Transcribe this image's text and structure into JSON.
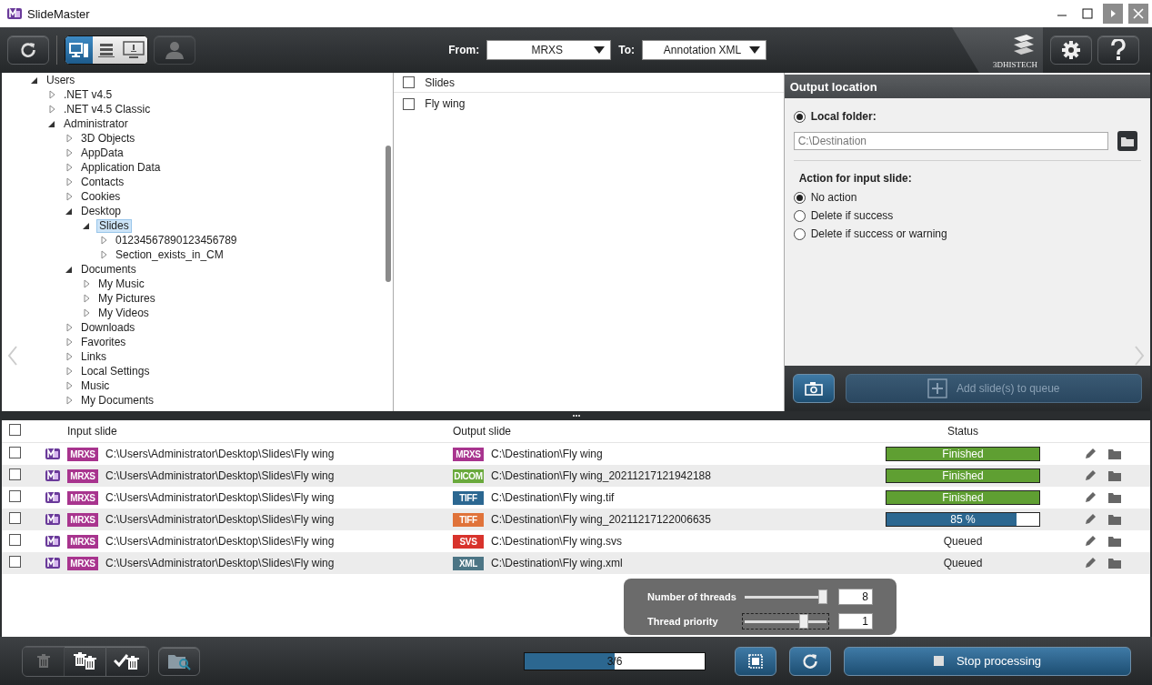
{
  "window": {
    "title": "SlideMaster"
  },
  "toolbar": {
    "view_modes": [
      {
        "selected": true
      },
      {
        "selected": false
      },
      {
        "selected": false
      }
    ],
    "from": {
      "label": "From:",
      "value": "MRXS"
    },
    "to": {
      "label": "To:",
      "value": "Annotation XML"
    },
    "logo": "3DHISTECH"
  },
  "tree": [
    {
      "label": "Users",
      "expanded": true,
      "selected": false,
      "children": [
        {
          "label": ".NET v4.5",
          "expanded": false,
          "selected": false
        },
        {
          "label": ".NET v4.5 Classic",
          "expanded": false,
          "selected": false
        },
        {
          "label": "Administrator",
          "expanded": true,
          "selected": false,
          "children": [
            {
              "label": "3D Objects",
              "expanded": false,
              "selected": false
            },
            {
              "label": "AppData",
              "expanded": false,
              "selected": false
            },
            {
              "label": "Application Data",
              "expanded": false,
              "selected": false
            },
            {
              "label": "Contacts",
              "expanded": false,
              "selected": false
            },
            {
              "label": "Cookies",
              "expanded": false,
              "selected": false
            },
            {
              "label": "Desktop",
              "expanded": true,
              "selected": false,
              "children": [
                {
                  "label": "Slides",
                  "expanded": true,
                  "selected": true,
                  "children": [
                    {
                      "label": "01234567890123456789",
                      "expanded": false,
                      "selected": false
                    },
                    {
                      "label": "Section_exists_in_CM",
                      "expanded": false,
                      "selected": false
                    }
                  ]
                }
              ]
            },
            {
              "label": "Documents",
              "expanded": true,
              "selected": false,
              "children": [
                {
                  "label": "My Music",
                  "expanded": false,
                  "selected": false
                },
                {
                  "label": "My Pictures",
                  "expanded": false,
                  "selected": false
                },
                {
                  "label": "My Videos",
                  "expanded": false,
                  "selected": false
                }
              ]
            },
            {
              "label": "Downloads",
              "expanded": false,
              "selected": false
            },
            {
              "label": "Favorites",
              "expanded": false,
              "selected": false
            },
            {
              "label": "Links",
              "expanded": false,
              "selected": false
            },
            {
              "label": "Local Settings",
              "expanded": false,
              "selected": false
            },
            {
              "label": "Music",
              "expanded": false,
              "selected": false
            },
            {
              "label": "My Documents",
              "expanded": false,
              "selected": false
            }
          ]
        }
      ]
    }
  ],
  "slides": {
    "header": {
      "label": "Slides",
      "checked": false
    },
    "items": [
      {
        "label": "Fly wing",
        "checked": false
      }
    ]
  },
  "output": {
    "title": "Output location",
    "local_folder": {
      "label": "Local folder:",
      "selected": true
    },
    "path": "C:\\Destination",
    "action_label": "Action for input slide:",
    "actions": [
      {
        "label": "No action",
        "selected": true
      },
      {
        "label": "Delete if success",
        "selected": false
      },
      {
        "label": "Delete if success or warning",
        "selected": false
      }
    ],
    "add_button": {
      "label": "Add slide(s) to queue",
      "disabled": true
    }
  },
  "queue": {
    "columns": [
      "Input slide",
      "Output slide",
      "Status"
    ],
    "all_checked": false,
    "rows": [
      {
        "checked": false,
        "input_format": {
          "label": "MRXS",
          "color": "#a8348e"
        },
        "input_path": "C:\\Users\\Administrator\\Desktop\\Slides\\Fly wing",
        "output_format": {
          "label": "MRXS",
          "color": "#a8348e"
        },
        "output_path": "C:\\Destination\\Fly wing",
        "status": {
          "kind": "finished",
          "text": "Finished",
          "level": 1
        }
      },
      {
        "checked": false,
        "input_format": {
          "label": "MRXS",
          "color": "#a8348e"
        },
        "input_path": "C:\\Users\\Administrator\\Desktop\\Slides\\Fly wing",
        "output_format": {
          "label": "DICOM",
          "color": "#6aa93c"
        },
        "output_path": "C:\\Destination\\Fly wing_20211217121942188",
        "status": {
          "kind": "finished",
          "text": "Finished",
          "level": 1
        }
      },
      {
        "checked": false,
        "input_format": {
          "label": "MRXS",
          "color": "#a8348e"
        },
        "input_path": "C:\\Users\\Administrator\\Desktop\\Slides\\Fly wing",
        "output_format": {
          "label": "TIFF",
          "color": "#2b6791"
        },
        "output_path": "C:\\Destination\\Fly wing.tif",
        "status": {
          "kind": "finished",
          "text": "Finished",
          "level": 1
        }
      },
      {
        "checked": false,
        "input_format": {
          "label": "MRXS",
          "color": "#a8348e"
        },
        "input_path": "C:\\Users\\Administrator\\Desktop\\Slides\\Fly wing",
        "output_format": {
          "label": "TIFF",
          "color": "#e0733a"
        },
        "output_path": "C:\\Destination\\Fly wing_20211217122006635",
        "status": {
          "kind": "progress",
          "text": "85 %",
          "level": 0.85
        }
      },
      {
        "checked": false,
        "input_format": {
          "label": "MRXS",
          "color": "#a8348e"
        },
        "input_path": "C:\\Users\\Administrator\\Desktop\\Slides\\Fly wing",
        "output_format": {
          "label": "SVS",
          "color": "#d8332c"
        },
        "output_path": "C:\\Destination\\Fly wing.svs",
        "status": {
          "kind": "queued",
          "text": "Queued"
        }
      },
      {
        "checked": false,
        "input_format": {
          "label": "MRXS",
          "color": "#a8348e"
        },
        "input_path": "C:\\Users\\Administrator\\Desktop\\Slides\\Fly wing",
        "output_format": {
          "label": "XML",
          "color": "#4c7585"
        },
        "output_path": "C:\\Destination\\Fly wing.xml",
        "status": {
          "kind": "queued",
          "text": "Queued"
        }
      }
    ]
  },
  "threads": [
    {
      "label": "Number of threads",
      "level": 0.95,
      "value": "8",
      "focused": false
    },
    {
      "label": "Thread priority",
      "level": 0.72,
      "value": "1",
      "focused": true
    }
  ],
  "footer": {
    "progress": {
      "text": "3/6",
      "level": 0.5
    },
    "stop_button": "Stop processing"
  }
}
